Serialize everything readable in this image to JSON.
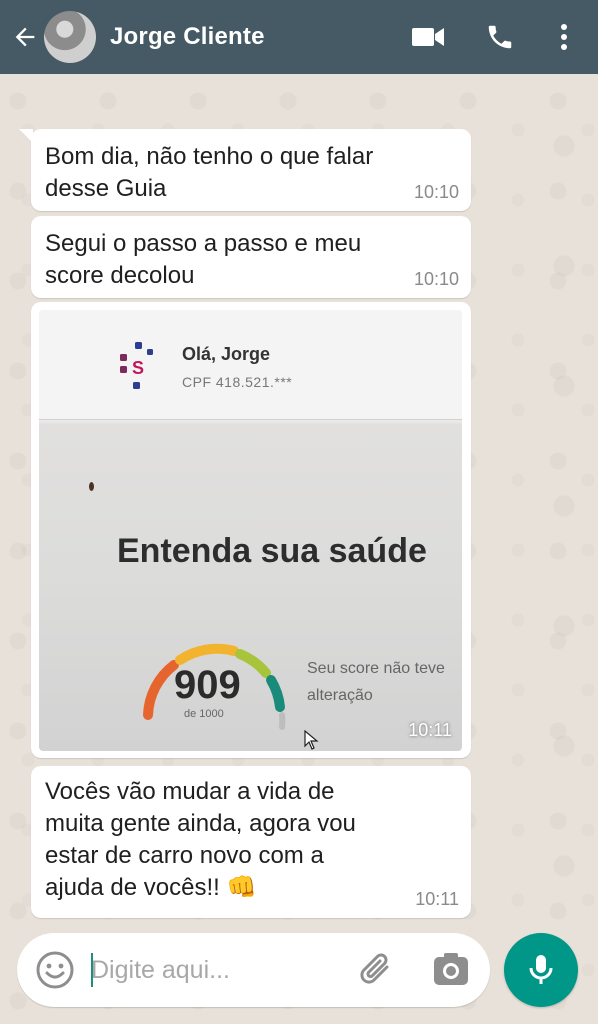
{
  "header": {
    "contact_name": "Jorge Cliente",
    "icons": [
      "back-arrow-icon",
      "video-call-icon",
      "phone-icon",
      "more-vertical-icon"
    ]
  },
  "messages": [
    {
      "type": "text",
      "text": "Bom dia, não tenho o que falar desse Guia",
      "time": "10:10"
    },
    {
      "type": "text",
      "text": "Segui o passo a passo e meu score decolou",
      "time": "10:10"
    },
    {
      "type": "image",
      "time": "10:11",
      "photo": {
        "logo_letter": "S",
        "greeting": "Olá, Jorge",
        "cpf": "CPF 418.521.***",
        "headline": "Entenda sua saúde",
        "score": "909",
        "score_of": "de 1000",
        "status": "Seu score não teve alteração"
      }
    },
    {
      "type": "text",
      "text": "Vocês vão mudar a vida de muita gente ainda, agora vou estar de carro novo com a ajuda de vocês!! 👊",
      "time": "10:11"
    }
  ],
  "composer": {
    "placeholder": "Digite aqui...",
    "icons": [
      "emoji-icon",
      "paperclip-icon",
      "camera-icon",
      "microphone-icon"
    ]
  },
  "colors": {
    "header": "#455a64",
    "chat_background": "#e8e1d9",
    "bubble": "#ffffff",
    "accent": "#009688",
    "gauge": [
      "#e6642e",
      "#f2b42e",
      "#a7c43a",
      "#1a8a7a"
    ]
  }
}
